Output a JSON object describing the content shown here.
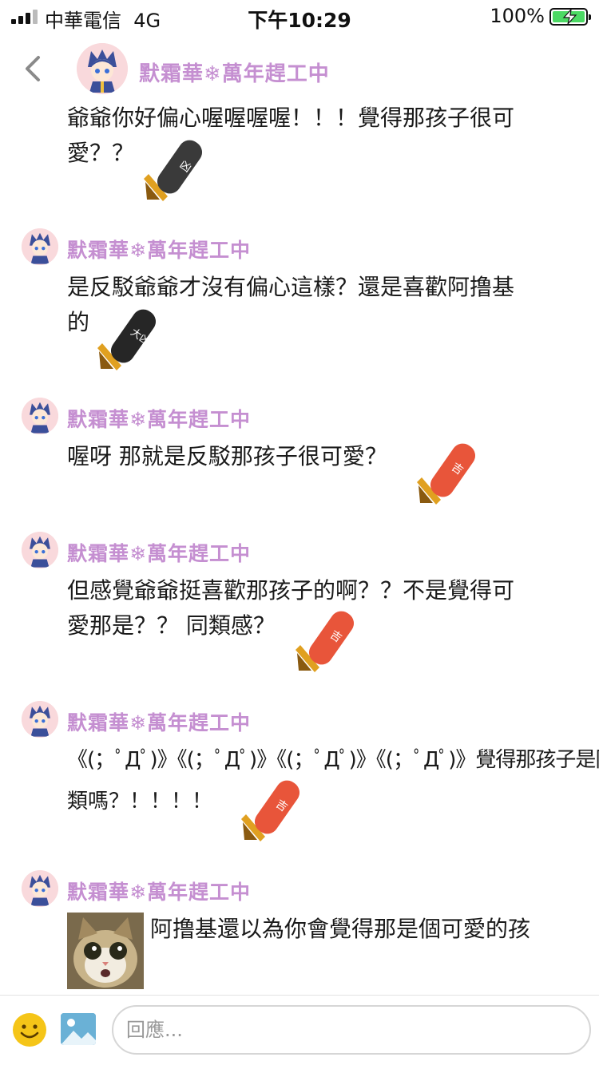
{
  "status_bar": {
    "carrier": "中華電信",
    "network": "4G",
    "time": "下午10:29",
    "battery": "100%"
  },
  "header": {
    "name": "默霜華❄萬年趕工中"
  },
  "messages": [
    {
      "name": "默霜華❄萬年趕工中",
      "lines": [
        "爺爺你好偏心喔喔喔喔！！！覺得那孩子很可",
        "愛？？"
      ],
      "sticker": "凶"
    },
    {
      "name": "默霜華❄萬年趕工中",
      "lines": [
        "是反駁爺爺才沒有偏心這樣？還是喜歡阿撸基",
        "的"
      ],
      "sticker": "大凶"
    },
    {
      "name": "默霜華❄萬年趕工中",
      "lines": [
        "喔呀 那就是反駁那孩子很可愛？"
      ],
      "sticker": "吉"
    },
    {
      "name": "默霜華❄萬年趕工中",
      "lines": [
        "但感覺爺爺挺喜歡那孩子的啊？？不是覺得可",
        "愛那是？？ 同類感？"
      ],
      "sticker": "吉"
    },
    {
      "name": "默霜華❄萬年趕工中",
      "lines": [
        "《(；ﾟДﾟ)》《(；ﾟДﾟ)》《(；ﾟДﾟ)》《(；ﾟДﾟ)》覺得那孩子是同",
        "類嗎？！！！！"
      ],
      "sticker": "吉"
    },
    {
      "name": "默霜華❄萬年趕工中",
      "lines": [
        "阿撸基還以為你會覺得那是個可愛的孩"
      ]
    }
  ],
  "reply": {
    "placeholder": "回應..."
  },
  "colors": {
    "name": "#c58fd1",
    "text": "#1a1a1a",
    "sticker_dark": "#2e2e2e",
    "sticker_red": "#e8553a"
  },
  "icons": [
    "back-chevron-icon",
    "emoji-icon",
    "image-icon",
    "signal-icon",
    "battery-charging-icon"
  ]
}
